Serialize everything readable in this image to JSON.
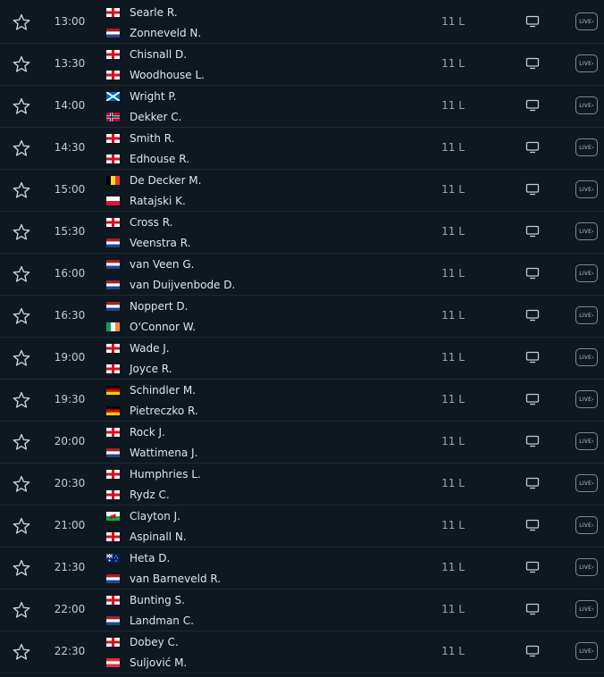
{
  "colors": {
    "background": "#0d1821",
    "row_divider": "#1e2a34",
    "text_primary": "#dfe5ea",
    "text_muted": "#9aa5ae"
  },
  "icons": {
    "favorite": "star-outline-icon",
    "broadcast": "tv-icon",
    "live": "live-badge"
  },
  "matches": [
    {
      "time": "13:00",
      "p1": {
        "name": "Searle R.",
        "flag": "ENG"
      },
      "p2": {
        "name": "Zonneveld N.",
        "flag": "NED"
      },
      "league": "11 L",
      "live": "LIVE›"
    },
    {
      "time": "13:30",
      "p1": {
        "name": "Chisnall D.",
        "flag": "ENG"
      },
      "p2": {
        "name": "Woodhouse L.",
        "flag": "ENG"
      },
      "league": "11 L",
      "live": "LIVE›"
    },
    {
      "time": "14:00",
      "p1": {
        "name": "Wright P.",
        "flag": "SCO"
      },
      "p2": {
        "name": "Dekker C.",
        "flag": "NOR"
      },
      "league": "11 L",
      "live": "LIVE›"
    },
    {
      "time": "14:30",
      "p1": {
        "name": "Smith R.",
        "flag": "ENG"
      },
      "p2": {
        "name": "Edhouse R.",
        "flag": "ENG"
      },
      "league": "11 L",
      "live": "LIVE›"
    },
    {
      "time": "15:00",
      "p1": {
        "name": "De Decker M.",
        "flag": "BEL"
      },
      "p2": {
        "name": "Ratajski K.",
        "flag": "POL"
      },
      "league": "11 L",
      "live": "LIVE›"
    },
    {
      "time": "15:30",
      "p1": {
        "name": "Cross R.",
        "flag": "ENG"
      },
      "p2": {
        "name": "Veenstra R.",
        "flag": "NED"
      },
      "league": "11 L",
      "live": "LIVE›"
    },
    {
      "time": "16:00",
      "p1": {
        "name": "van Veen G.",
        "flag": "NED"
      },
      "p2": {
        "name": "van Duijvenbode D.",
        "flag": "NED"
      },
      "league": "11 L",
      "live": "LIVE›"
    },
    {
      "time": "16:30",
      "p1": {
        "name": "Noppert D.",
        "flag": "NED"
      },
      "p2": {
        "name": "O'Connor W.",
        "flag": "IRL"
      },
      "league": "11 L",
      "live": "LIVE›"
    },
    {
      "time": "19:00",
      "p1": {
        "name": "Wade J.",
        "flag": "ENG"
      },
      "p2": {
        "name": "Joyce R.",
        "flag": "ENG"
      },
      "league": "11 L",
      "live": "LIVE›"
    },
    {
      "time": "19:30",
      "p1": {
        "name": "Schindler M.",
        "flag": "GER"
      },
      "p2": {
        "name": "Pietreczko R.",
        "flag": "GER"
      },
      "league": "11 L",
      "live": "LIVE›"
    },
    {
      "time": "20:00",
      "p1": {
        "name": "Rock J.",
        "flag": "ENG"
      },
      "p2": {
        "name": "Wattimena J.",
        "flag": "NED"
      },
      "league": "11 L",
      "live": "LIVE›"
    },
    {
      "time": "20:30",
      "p1": {
        "name": "Humphries L.",
        "flag": "ENG"
      },
      "p2": {
        "name": "Rydz C.",
        "flag": "ENG"
      },
      "league": "11 L",
      "live": "LIVE›"
    },
    {
      "time": "21:00",
      "p1": {
        "name": "Clayton J.",
        "flag": "WAL"
      },
      "p2": {
        "name": "Aspinall N.",
        "flag": "ENG"
      },
      "league": "11 L",
      "live": "LIVE›"
    },
    {
      "time": "21:30",
      "p1": {
        "name": "Heta D.",
        "flag": "AUS"
      },
      "p2": {
        "name": "van Barneveld R.",
        "flag": "NED"
      },
      "league": "11 L",
      "live": "LIVE›"
    },
    {
      "time": "22:00",
      "p1": {
        "name": "Bunting S.",
        "flag": "ENG"
      },
      "p2": {
        "name": "Landman C.",
        "flag": "NED"
      },
      "league": "11 L",
      "live": "LIVE›"
    },
    {
      "time": "22:30",
      "p1": {
        "name": "Dobey C.",
        "flag": "ENG"
      },
      "p2": {
        "name": "Suljović M.",
        "flag": "AUT"
      },
      "league": "11 L",
      "live": "LIVE›"
    }
  ]
}
